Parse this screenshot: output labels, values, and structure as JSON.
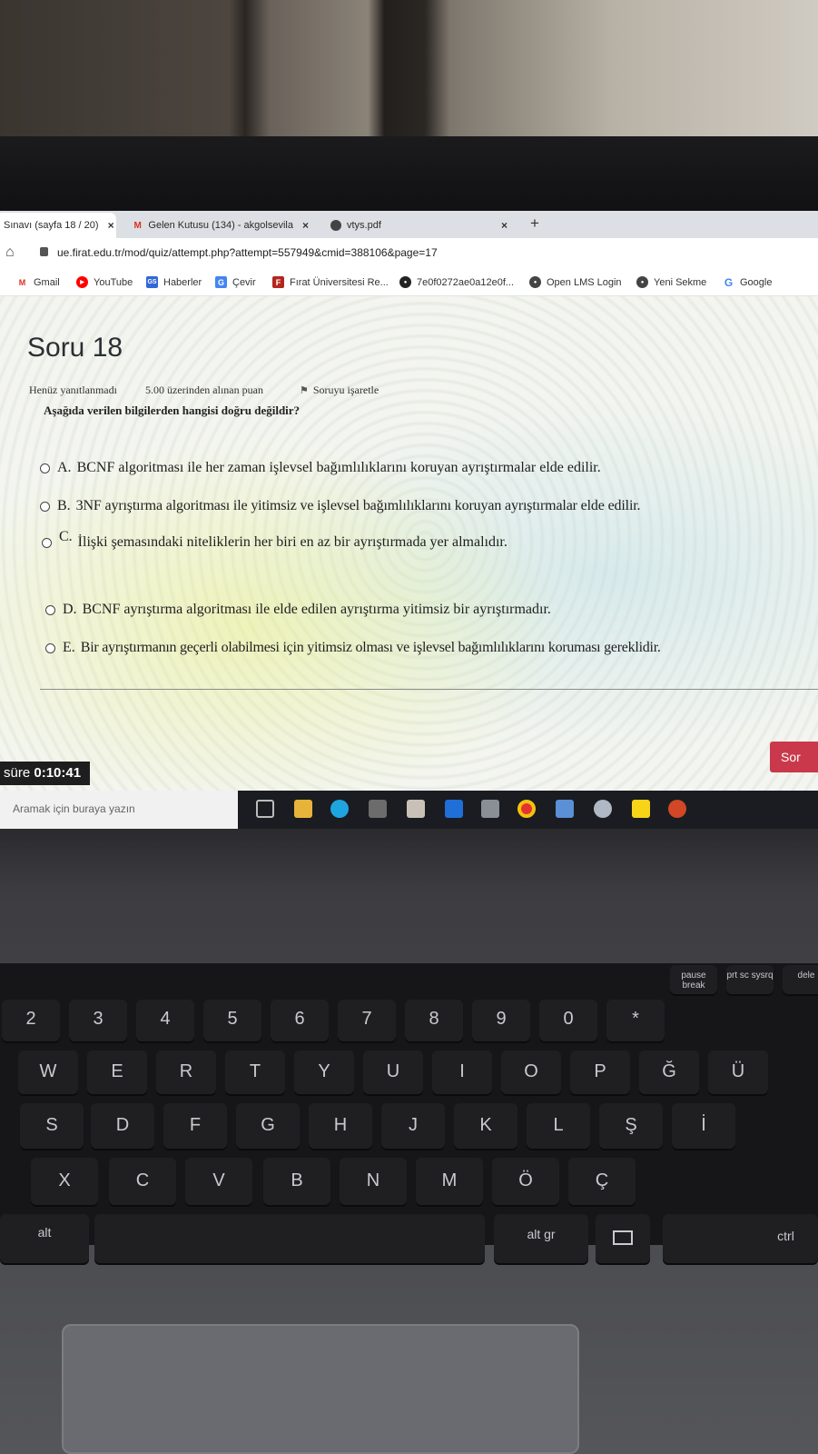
{
  "browser": {
    "tabs": [
      {
        "label": "Sınavı (sayfa 18 / 20)",
        "icon": "quiz-icon"
      },
      {
        "label": "Gelen Kutusu (134) - akgolsevila",
        "icon": "gmail-icon"
      },
      {
        "label": "vtys.pdf",
        "icon": "globe-icon"
      }
    ],
    "new_tab": "+",
    "close_symbol": "×",
    "url": "ue.firat.edu.tr/mod/quiz/attempt.php?attempt=557949&cmid=388106&page=17"
  },
  "bookmarks": [
    {
      "label": "Gmail",
      "icon": "gmail-icon",
      "color": "#d93025",
      "glyph": "M"
    },
    {
      "label": "YouTube",
      "icon": "youtube-icon",
      "color": "#ff0000",
      "glyph": "▶"
    },
    {
      "label": "Haberler",
      "icon": "news-icon",
      "color": "#3367d6",
      "glyph": "GS"
    },
    {
      "label": "Çevir",
      "icon": "translate-icon",
      "color": "#4285f4",
      "glyph": "G"
    },
    {
      "label": "Fırat Üniversitesi Re...",
      "icon": "university-icon",
      "color": "#b3261e",
      "glyph": "F"
    },
    {
      "label": "7e0f0272ae0a12e0f...",
      "icon": "github-icon",
      "color": "#222222",
      "glyph": "●"
    },
    {
      "label": "Open LMS Login",
      "icon": "globe-icon",
      "color": "#444444",
      "glyph": "●"
    },
    {
      "label": "Yeni Sekme",
      "icon": "globe-icon",
      "color": "#444444",
      "glyph": "●"
    },
    {
      "label": "Google",
      "icon": "google-icon",
      "color": "#4285f4",
      "glyph": "G"
    }
  ],
  "quiz": {
    "title": "Soru 18",
    "status": "Henüz yanıtlanmadı",
    "points": "5.00 üzerinden alınan puan",
    "flag_label": "Soruyu işaretle",
    "question": "Aşağıda verilen bilgilerden hangisi doğru değildir?",
    "options": [
      {
        "letter": "A.",
        "text": "BCNF algoritması ile her zaman işlevsel bağımlılıklarını koruyan ayrıştırmalar elde edilir."
      },
      {
        "letter": "B.",
        "text": "3NF ayrıştırma algoritması ile yitimsiz ve işlevsel bağımlılıklarını koruyan ayrıştırmalar elde edilir."
      },
      {
        "letter": "C.",
        "text": "İlişki şemasındaki niteliklerin her biri en az bir ayrıştırmada yer almalıdır."
      },
      {
        "letter": "D.",
        "text": "BCNF ayrıştırma algoritması ile elde edilen ayrıştırma yitimsiz bir ayrıştırmadır."
      },
      {
        "letter": "E.",
        "text": "Bir ayrıştırmanın geçerli olabilmesi için yitimsiz olması ve işlevsel bağımlılıklarını koruması gereklidir."
      }
    ],
    "timer_label": "süre",
    "timer_value": "0:10:41",
    "next_button": "Sor"
  },
  "taskbar": {
    "search_placeholder": "Aramak için buraya yazın",
    "icons": [
      "task-view-icon",
      "file-explorer-icon",
      "edge-icon",
      "store-icon",
      "gift-icon",
      "mail-icon",
      "usb-icon",
      "chrome-icon",
      "photos-icon",
      "paint-icon",
      "sticky-notes-icon",
      "powerpoint-icon"
    ]
  },
  "keyboard": {
    "fn_labels": [
      "pause break",
      "prt sc sysrq",
      "dele"
    ],
    "row1": [
      "2",
      "3",
      "4",
      "5",
      "6",
      "7",
      "8",
      "9",
      "0",
      "*"
    ],
    "row2": [
      "W",
      "E",
      "R",
      "T",
      "Y",
      "U",
      "I",
      "O",
      "P",
      "Ğ",
      "Ü"
    ],
    "row3": [
      "S",
      "D",
      "F",
      "G",
      "H",
      "J",
      "K",
      "L",
      "Ş",
      "İ"
    ],
    "row4": [
      "X",
      "C",
      "V",
      "B",
      "N",
      "M",
      "Ö",
      "Ç"
    ],
    "row5": [
      "alt",
      "alt gr",
      "ctrl"
    ]
  }
}
